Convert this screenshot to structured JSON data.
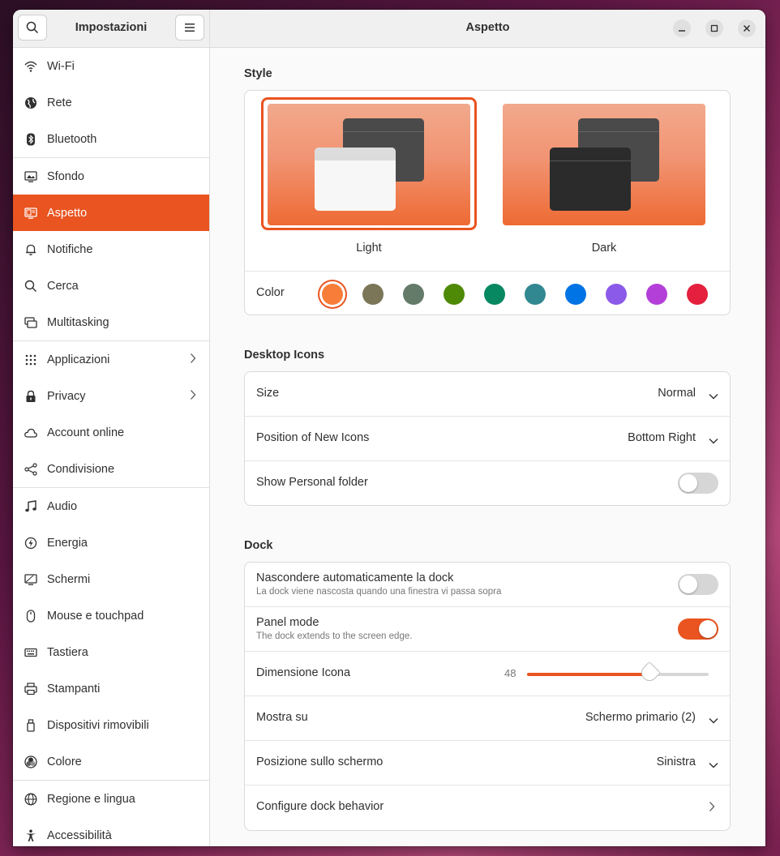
{
  "sidebar": {
    "title": "Impostazioni",
    "items": [
      {
        "label": "Wi-Fi",
        "icon": "wifi-icon"
      },
      {
        "label": "Rete",
        "icon": "globe-icon"
      },
      {
        "label": "Bluetooth",
        "icon": "bluetooth-icon"
      },
      {
        "label": "Sfondo",
        "icon": "monitor-icon"
      },
      {
        "label": "Aspetto",
        "icon": "appearance-icon"
      },
      {
        "label": "Notifiche",
        "icon": "bell-icon"
      },
      {
        "label": "Cerca",
        "icon": "search-icon"
      },
      {
        "label": "Multitasking",
        "icon": "multitasking-icon"
      },
      {
        "label": "Applicazioni",
        "icon": "apps-grid-icon"
      },
      {
        "label": "Privacy",
        "icon": "lock-icon"
      },
      {
        "label": "Account online",
        "icon": "cloud-icon"
      },
      {
        "label": "Condivisione",
        "icon": "share-icon"
      },
      {
        "label": "Audio",
        "icon": "music-note-icon"
      },
      {
        "label": "Energia",
        "icon": "power-icon"
      },
      {
        "label": "Schermi",
        "icon": "display-icon"
      },
      {
        "label": "Mouse e touchpad",
        "icon": "mouse-icon"
      },
      {
        "label": "Tastiera",
        "icon": "keyboard-icon"
      },
      {
        "label": "Stampanti",
        "icon": "printer-icon"
      },
      {
        "label": "Dispositivi rimovibili",
        "icon": "usb-icon"
      },
      {
        "label": "Colore",
        "icon": "color-icon"
      },
      {
        "label": "Regione e lingua",
        "icon": "globe-icon"
      },
      {
        "label": "Accessibilità",
        "icon": "accessibility-icon"
      }
    ]
  },
  "main": {
    "title": "Aspetto",
    "style": {
      "section_title": "Style",
      "light_label": "Light",
      "dark_label": "Dark",
      "color_label": "Color",
      "accent_colors": [
        "#f77d38",
        "#7b7658",
        "#657b69",
        "#4e8a05",
        "#078861",
        "#318891",
        "#0073e5",
        "#8c5ae8",
        "#b33fd8",
        "#e4203e"
      ],
      "selected_color": "#f77d38"
    },
    "desktop_icons": {
      "section_title": "Desktop Icons",
      "size_label": "Size",
      "size_value": "Normal",
      "position_label": "Position of New Icons",
      "position_value": "Bottom Right",
      "personal_label": "Show Personal folder",
      "personal_on": false
    },
    "dock": {
      "section_title": "Dock",
      "autohide_label": "Nascondere automaticamente la dock",
      "autohide_sub": "La dock viene nascosta quando una finestra vi passa sopra",
      "autohide_on": false,
      "panel_label": "Panel mode",
      "panel_sub": "The dock extends to the screen edge.",
      "panel_on": true,
      "icon_size_label": "Dimensione Icona",
      "icon_size_value": "48",
      "icon_size_fraction": 0.67,
      "show_on_label": "Mostra su",
      "show_on_value": "Schermo primario (2)",
      "position_label": "Posizione sullo schermo",
      "position_value": "Sinistra",
      "behavior_label": "Configure dock behavior"
    }
  },
  "colors": {
    "accent": "#e95420"
  }
}
